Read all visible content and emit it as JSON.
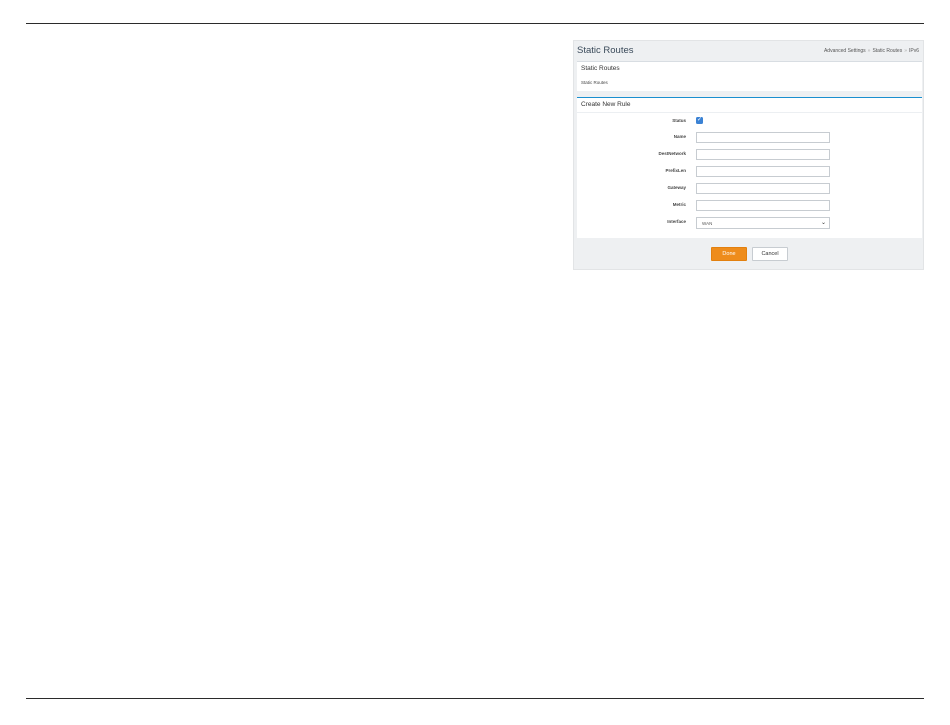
{
  "page": {
    "title": "Static Routes",
    "breadcrumb": [
      "Advanced Settings",
      "Static Routes",
      "IPv6"
    ],
    "separator": "»"
  },
  "static_routes_card": {
    "heading": "Static Routes",
    "link": "Static Routes"
  },
  "create_rule_card": {
    "heading": "Create New Rule",
    "fields": {
      "status": {
        "label": "Status",
        "checked": true,
        "check_glyph": "✓"
      },
      "name": {
        "label": "Name",
        "value": ""
      },
      "dest_network": {
        "label": "DestNetwork",
        "value": ""
      },
      "prefix_len": {
        "label": "PrefixLen",
        "value": ""
      },
      "gateway": {
        "label": "Gateway",
        "value": ""
      },
      "metric": {
        "label": "Metric",
        "value": ""
      },
      "interface": {
        "label": "Interface",
        "value": "WAN",
        "chevron": "⌄"
      }
    }
  },
  "actions": {
    "done_label": "Done",
    "cancel_label": "Cancel"
  },
  "colors": {
    "accent": "#1a8fcf",
    "primary_button": "#ee8c1b",
    "checkbox": "#3b82d4"
  }
}
